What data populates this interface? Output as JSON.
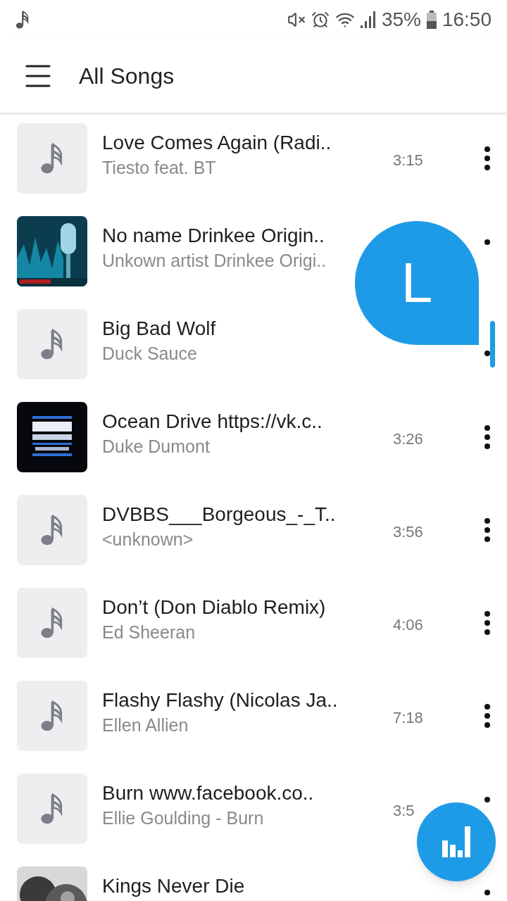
{
  "status_bar": {
    "battery": "35%",
    "time": "16:50"
  },
  "toolbar": {
    "title": "All Songs"
  },
  "songs": [
    {
      "title": "Love Comes Again (Radi..",
      "artist": "Tiesto feat. BT",
      "duration": "3:15",
      "kind": "note",
      "menu": {
        "kind": "all"
      }
    },
    {
      "title": "No name Drinkee Origin..",
      "artist": "Unkown artist Drinkee Origi..",
      "kind": "mic",
      "menu": {
        "kind": "top"
      }
    },
    {
      "title": "Big Bad Wolf",
      "artist": "Duck Sauce",
      "kind": "note",
      "menu": {
        "kind": "bottom"
      }
    },
    {
      "title": "Ocean Drive https://vk.c..",
      "artist": "Duke Dumont",
      "duration": "3:26",
      "kind": "album",
      "menu": {
        "kind": "all"
      }
    },
    {
      "title": "DVBBS___Borgeous_-_T..",
      "artist": "<unknown>",
      "duration": "3:56",
      "kind": "note",
      "menu": {
        "kind": "all"
      }
    },
    {
      "title": "Don’t (Don Diablo Remix)",
      "artist": "Ed Sheeran",
      "duration": "4:06",
      "kind": "note",
      "menu": {
        "kind": "all"
      }
    },
    {
      "title": "Flashy Flashy (Nicolas Ja..",
      "artist": "Ellen Allien",
      "duration": "7:18",
      "kind": "note",
      "menu": {
        "kind": "all"
      }
    },
    {
      "title": "Burn www.facebook.co..",
      "artist": "Ellie Goulding - Burn",
      "duration": "3:5",
      "kind": "note",
      "menu": {
        "kind": "top"
      }
    },
    {
      "title": "Kings Never Die",
      "kind": "grey",
      "menu": {
        "kind": "top"
      }
    }
  ],
  "fast_scroll": {
    "letter": "L"
  }
}
